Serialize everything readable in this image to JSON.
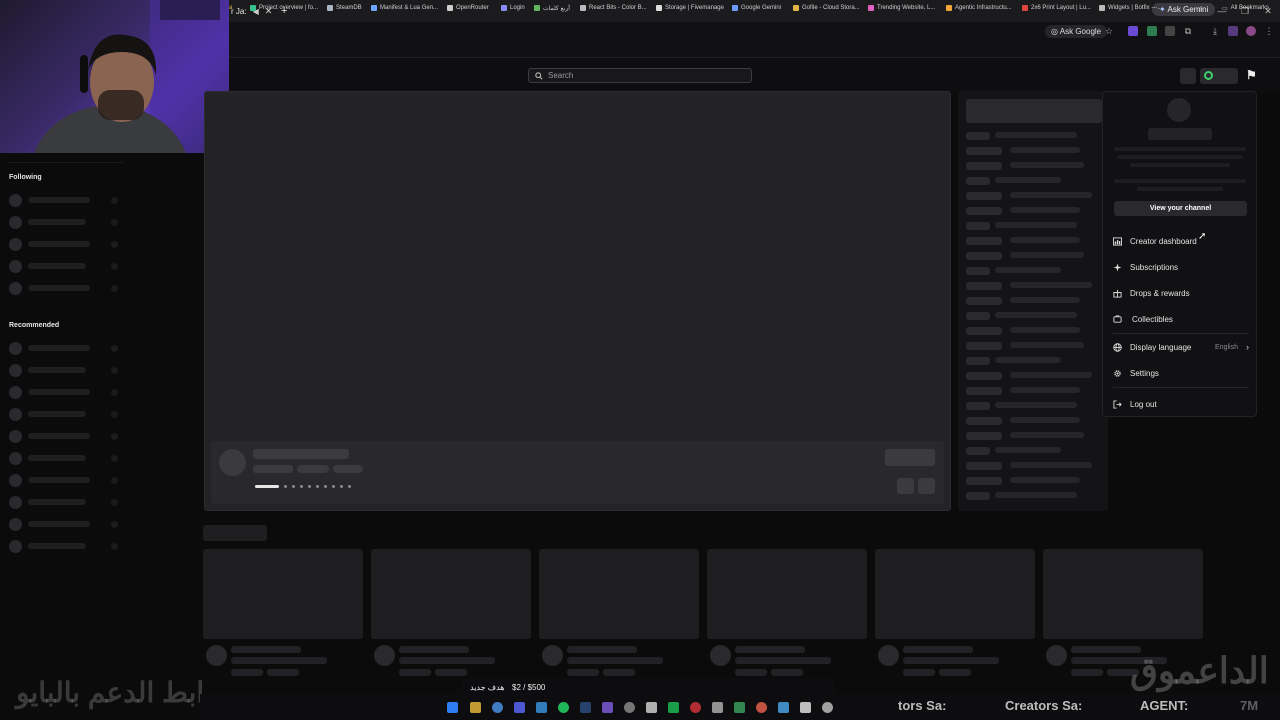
{
  "browser": {
    "active_tab_fragment": "r Ja:",
    "ask_gemini": "Ask Gemini",
    "ask_google": "Ask Google",
    "all_bookmarks": "All Bookmarks",
    "bookmarks": [
      {
        "label": "Project overview | fo...",
        "color": "#36c28a"
      },
      {
        "label": "SteamDB",
        "color": "#aab4c2"
      },
      {
        "label": "Manifest & Lua Gen...",
        "color": "#6aa6ff"
      },
      {
        "label": "OpenRouter",
        "color": "#cccccc"
      },
      {
        "label": "Login",
        "color": "#8a8aff"
      },
      {
        "label": "أربع كلمات",
        "color": "#5fb85f"
      },
      {
        "label": "React Bits - Color B...",
        "color": "#bbbbbb"
      },
      {
        "label": "Storage | Fivemanage",
        "color": "#dddddd"
      },
      {
        "label": "Google Gemini",
        "color": "#6b9bff"
      },
      {
        "label": "Gofile - Cloud Stora...",
        "color": "#e0b64a"
      },
      {
        "label": "Trending Website, L...",
        "color": "#e05fbf"
      },
      {
        "label": "Agentic Infrastructu...",
        "color": "#f0a53a"
      },
      {
        "label": "2x6 Print Layout | Lu...",
        "color": "#e0453a"
      },
      {
        "label": "Widgets | Botfix ---...",
        "color": "#bbbbbb"
      }
    ]
  },
  "site": {
    "search_placeholder": "Search"
  },
  "sidebar": {
    "following_label": "Following",
    "recommended_label": "Recommended"
  },
  "menu": {
    "view_channel": "View your channel",
    "items": [
      {
        "label": "Creator dashboard",
        "icon": "dashboard-icon"
      },
      {
        "label": "Subscriptions",
        "icon": "star-icon"
      },
      {
        "label": "Drops & rewards",
        "icon": "gift-icon"
      },
      {
        "label": "Collectibles",
        "icon": "collectibles-icon"
      }
    ],
    "display_language": "Display language",
    "display_language_value": "English",
    "settings": "Settings",
    "logout": "Log out"
  },
  "overlay": {
    "goal": "$2 / $500",
    "goal_label": "هدف جديد",
    "support_link": "رابط الدعم بالبايو",
    "brand": "الداعموق",
    "creators_label_1": "tors Sa:",
    "creators_label_2": "Creators Sa:",
    "agent_label": "AGENT:",
    "time": "7M"
  }
}
